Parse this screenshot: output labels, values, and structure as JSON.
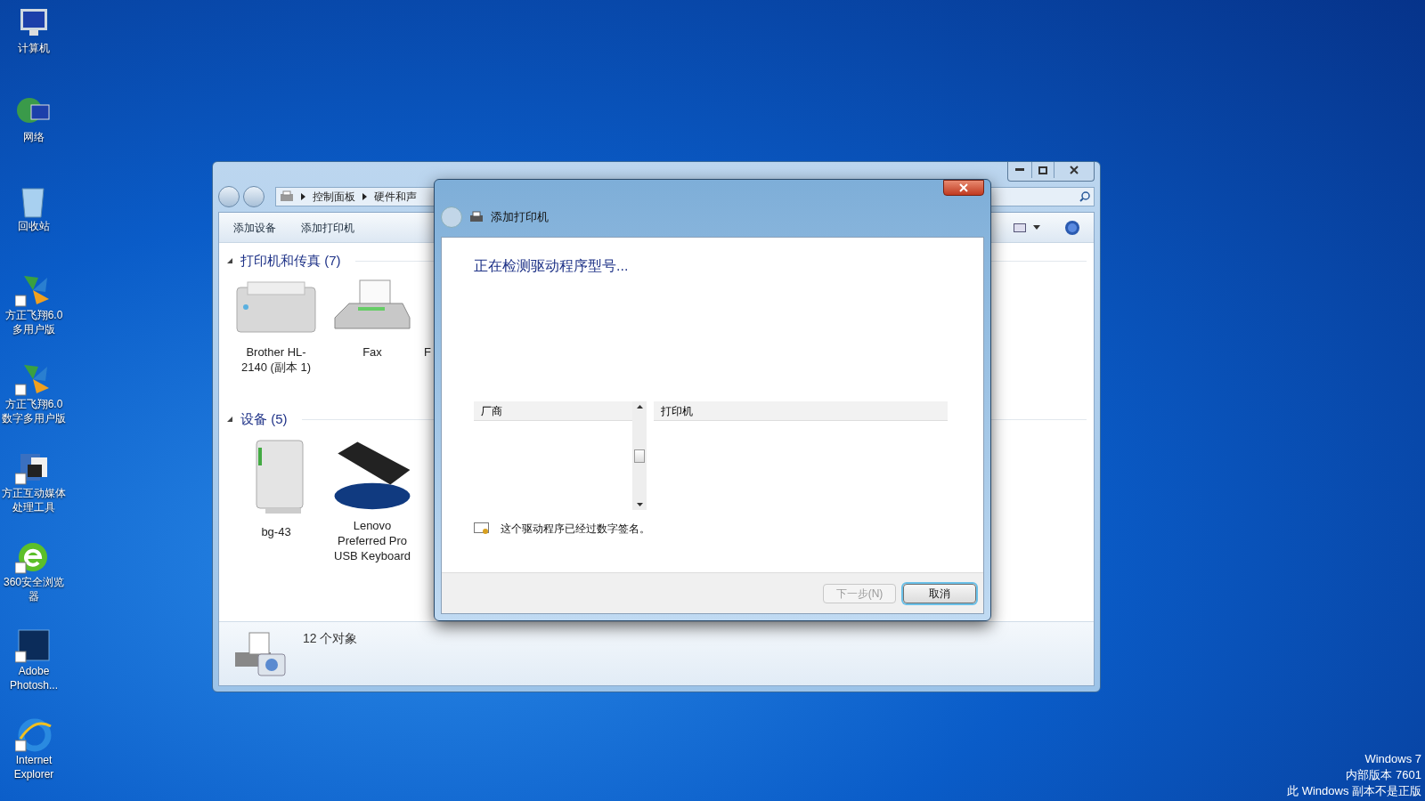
{
  "desktop_icons": [
    {
      "label": "计算机",
      "kind": "computer",
      "shortcut": false
    },
    {
      "label": "网络",
      "kind": "network",
      "shortcut": false
    },
    {
      "label": "回收站",
      "kind": "recycle",
      "shortcut": false
    },
    {
      "label": "方正飞翔6.0多用户版",
      "kind": "fan",
      "shortcut": true
    },
    {
      "label": "方正飞翔6.0数字多用户版",
      "kind": "fan",
      "shortcut": true
    },
    {
      "label": "方正互动媒体处理工具",
      "kind": "media",
      "shortcut": true
    },
    {
      "label": "360安全浏览器",
      "kind": "browser360",
      "shortcut": true
    },
    {
      "label": "Adobe Photosh...",
      "kind": "ps",
      "shortcut": true
    },
    {
      "label": "Internet Explorer",
      "kind": "ie",
      "shortcut": true
    }
  ],
  "explorer": {
    "breadcrumb": [
      "控制面板",
      "硬件和声"
    ],
    "toolbar": [
      "添加设备",
      "添加打印机"
    ],
    "groups": [
      {
        "title": "打印机和传真 (7)",
        "expanded": true,
        "items": [
          {
            "label": "Brother HL-2140 (副本 1)",
            "kind": "printer"
          },
          {
            "label": "Fax",
            "kind": "fax"
          },
          {
            "label": "F",
            "kind": "covered"
          }
        ]
      },
      {
        "title": "设备 (5)",
        "expanded": true,
        "items": [
          {
            "label": "bg-43",
            "kind": "drive"
          },
          {
            "label": "Lenovo Preferred Pro USB Keyboard",
            "kind": "keyboard"
          }
        ]
      }
    ],
    "status": "12 个对象"
  },
  "dialog": {
    "title": "添加打印机",
    "heading": "正在检测驱动程序型号...",
    "columns": [
      "厂商",
      "打印机"
    ],
    "signed_note": "这个驱动程序已经过数字签名。",
    "buttons": [
      {
        "label": "下一步(N)",
        "disabled": true,
        "default": false
      },
      {
        "label": "取消",
        "disabled": false,
        "default": true
      }
    ]
  },
  "os_notice": [
    "Windows 7",
    "内部版本 7601",
    "此 Windows 副本不是正版"
  ]
}
